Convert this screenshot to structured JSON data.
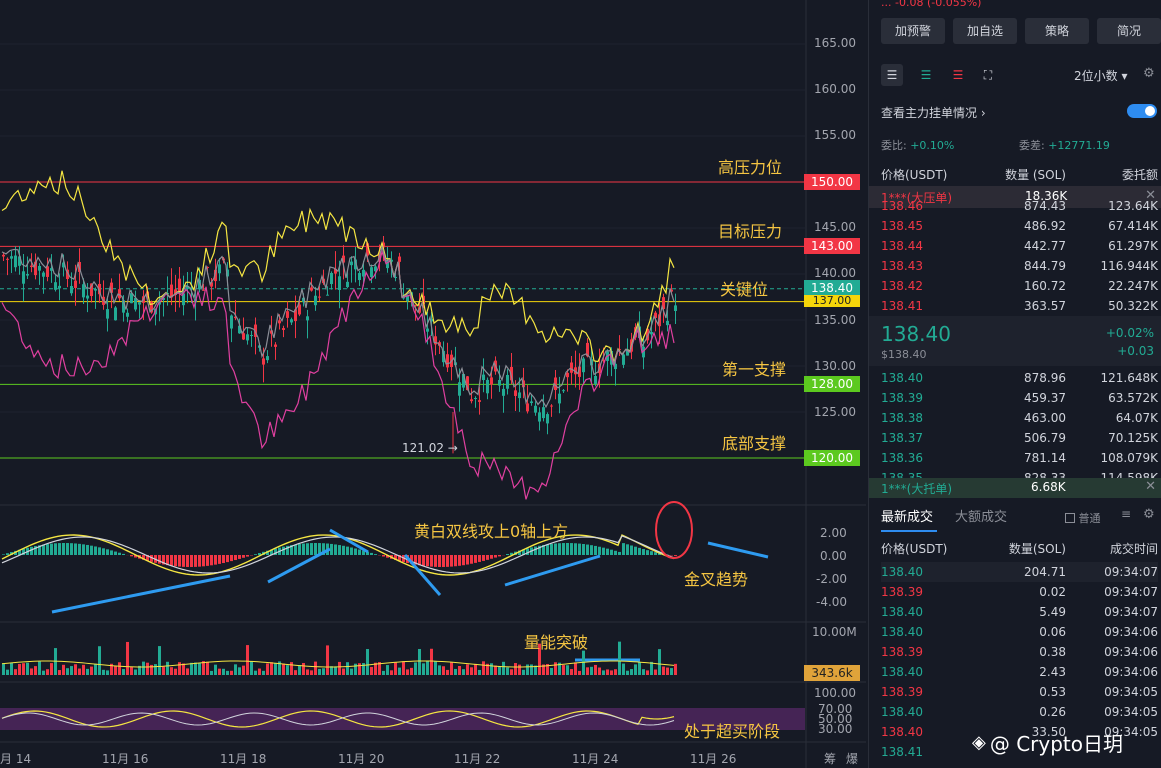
{
  "chart": {
    "y_ticks": [
      "165.00",
      "160.00",
      "155.00",
      "145.00",
      "140.00",
      "135.00",
      "130.00",
      "125.00"
    ],
    "date_ticks": [
      "月 14",
      "11月 16",
      "11月 18",
      "11月 20",
      "11月 22",
      "11月 24",
      "11月 26"
    ],
    "price_levels": [
      {
        "label": "150.00",
        "color": "#f23645"
      },
      {
        "label": "143.00",
        "color": "#f23645"
      },
      {
        "label": "138.40",
        "color": "#22ab94"
      },
      {
        "label": "137.00",
        "color": "#f5d50a"
      },
      {
        "label": "128.00",
        "color": "#5cc91f"
      },
      {
        "label": "120.00",
        "color": "#5cc91f"
      }
    ],
    "annotations": {
      "high_pressure": "高压力位",
      "target_pressure": "目标压力",
      "key_level": "关键位",
      "first_support": "第一支撑",
      "bottom_support": "底部支撑",
      "macd_note": "黄白双线攻上0轴上方",
      "golden_cross": "金叉趋势",
      "volume_break": "量能突破",
      "overbought": "处于超买阶段"
    },
    "low_marker": "121.02 →",
    "macd_ticks": [
      "2.00",
      "0.00",
      "-2.00",
      "-4.00"
    ],
    "volume_ticks": [
      "10.00M"
    ],
    "volume_value": "343.6k",
    "rsi_ticks": [
      "100.00",
      "70.00",
      "50.00",
      "30.00"
    ],
    "corner_labels": [
      "筹",
      "爆"
    ],
    "watermark": "@ Crypto日玥"
  },
  "panel": {
    "top_line": "...   -0.08 (-0.055%)",
    "buttons": [
      "加预警",
      "加自选",
      "策略",
      "简况"
    ],
    "decimals": "2位小数",
    "main_orders_label": "查看主力挂单情况",
    "weibi_label": "委比:",
    "weibi_value": "+0.10%",
    "weicha_label": "委差:",
    "weicha_value": "+12771.19",
    "col_price": "价格(USDT)",
    "col_qty": "数量 (SOL)",
    "col_amount": "委托额",
    "big_sell_label": "1***(大压单)",
    "big_sell_value": "18.36K",
    "asks": [
      {
        "price": "138.46",
        "qty": "874.43",
        "amt": "123.64K"
      },
      {
        "price": "138.45",
        "qty": "486.92",
        "amt": "67.414K"
      },
      {
        "price": "138.44",
        "qty": "442.77",
        "amt": "61.297K"
      },
      {
        "price": "138.43",
        "qty": "844.79",
        "amt": "116.944K"
      },
      {
        "price": "138.42",
        "qty": "160.72",
        "amt": "22.247K"
      },
      {
        "price": "138.41",
        "qty": "363.57",
        "amt": "50.322K"
      }
    ],
    "last_price": "138.40",
    "last_usd": "$138.40",
    "change_pct": "+0.02%",
    "change_abs": "+0.03",
    "bids": [
      {
        "price": "138.40",
        "qty": "878.96",
        "amt": "121.648K"
      },
      {
        "price": "138.39",
        "qty": "459.37",
        "amt": "63.572K"
      },
      {
        "price": "138.38",
        "qty": "463.00",
        "amt": "64.07K"
      },
      {
        "price": "138.37",
        "qty": "506.79",
        "amt": "70.125K"
      },
      {
        "price": "138.36",
        "qty": "781.14",
        "amt": "108.079K"
      },
      {
        "price": "138.35",
        "qty": "828.33",
        "amt": "114.598K"
      }
    ],
    "big_buy_label": "1***(大托单)",
    "big_buy_value": "6.68K",
    "tab_latest": "最新成交",
    "tab_big": "大额成交",
    "normal_label": "普通",
    "trade_col_price": "价格(USDT)",
    "trade_col_qty": "数量(SOL)",
    "trade_col_time": "成交时间",
    "trades": [
      {
        "price": "138.40",
        "qty": "204.71",
        "time": "09:34:07",
        "side": "buy"
      },
      {
        "price": "138.39",
        "qty": "0.02",
        "time": "09:34:07",
        "side": "sell"
      },
      {
        "price": "138.40",
        "qty": "5.49",
        "time": "09:34:07",
        "side": "buy"
      },
      {
        "price": "138.40",
        "qty": "0.06",
        "time": "09:34:06",
        "side": "buy"
      },
      {
        "price": "138.39",
        "qty": "0.38",
        "time": "09:34:06",
        "side": "sell"
      },
      {
        "price": "138.40",
        "qty": "2.43",
        "time": "09:34:06",
        "side": "buy"
      },
      {
        "price": "138.39",
        "qty": "0.53",
        "time": "09:34:05",
        "side": "sell"
      },
      {
        "price": "138.40",
        "qty": "0.26",
        "time": "09:34:05",
        "side": "buy"
      },
      {
        "price": "138.40",
        "qty": "33.50",
        "time": "09:34:05",
        "side": "sell"
      },
      {
        "price": "138.41",
        "qty": "",
        "time": "",
        "side": "buy"
      }
    ]
  }
}
